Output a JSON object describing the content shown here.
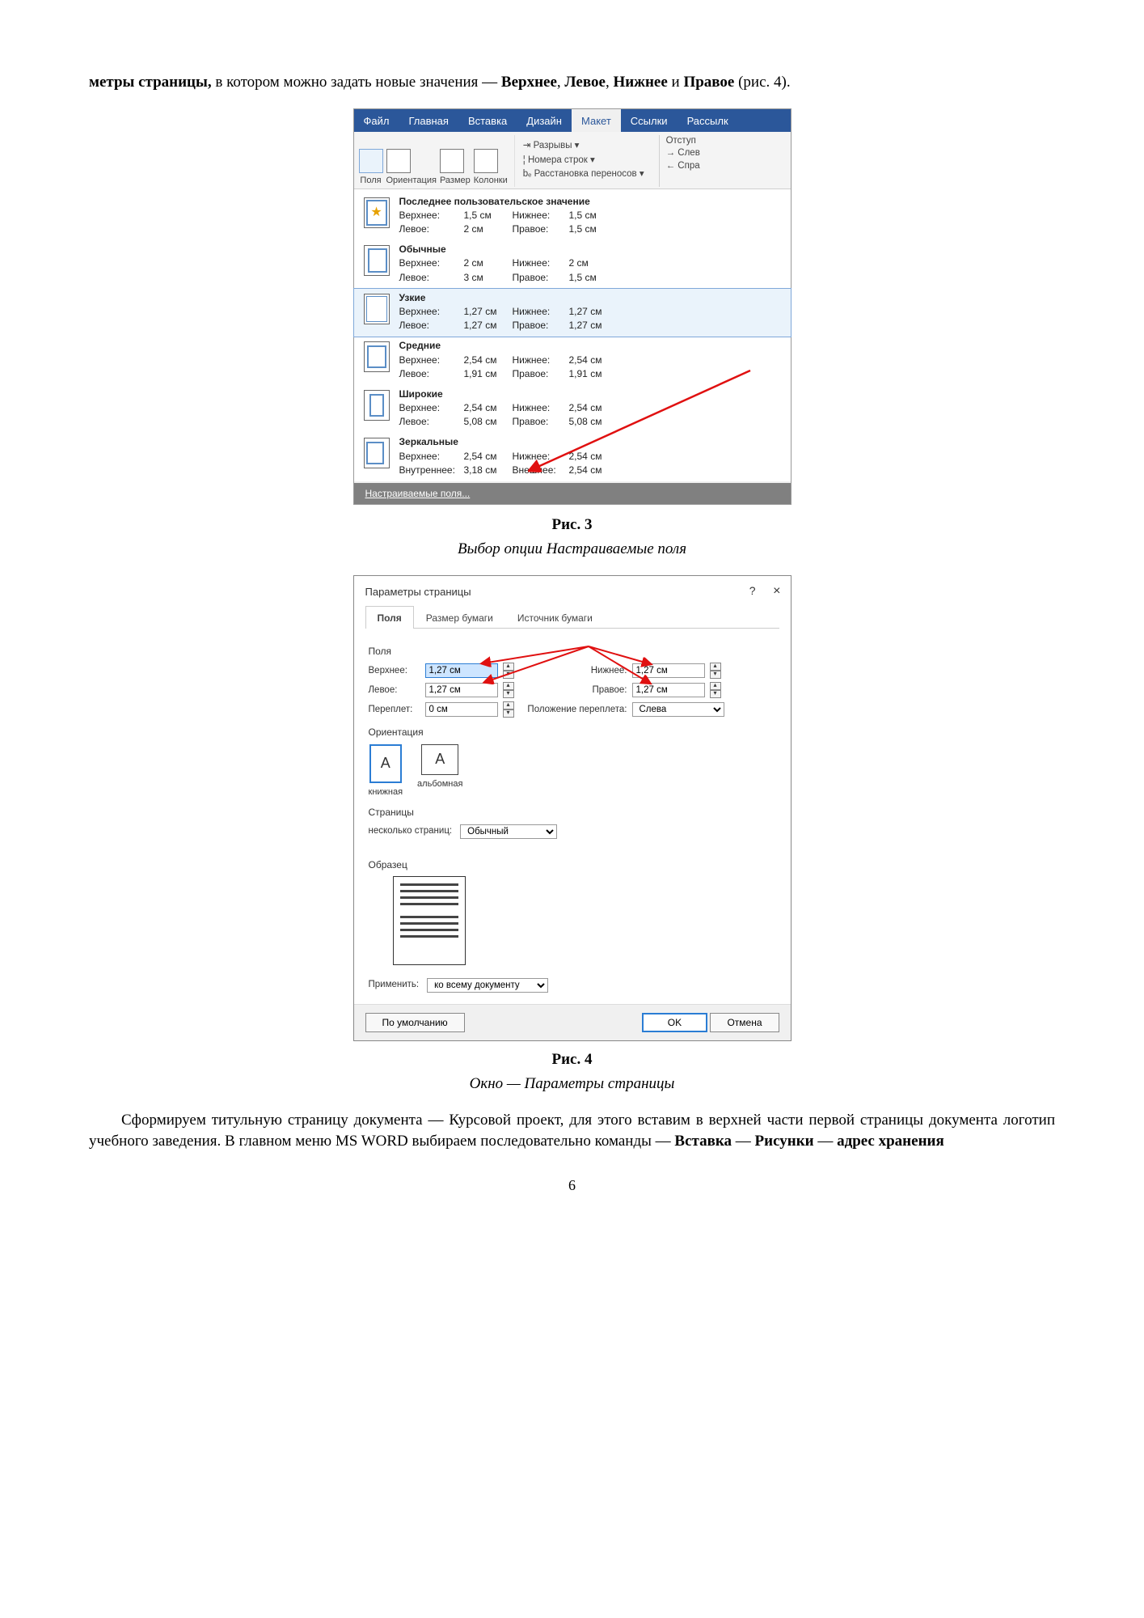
{
  "para1_prefix": "метры страницы,",
  "para1_mid": " в котором можно задать новые значения — ",
  "para1_names": [
    "Верхнее",
    "Левое",
    "Нижнее",
    "Правое"
  ],
  "para1_suffix": " (рис. 4).",
  "ribbon": {
    "tabs": [
      "Файл",
      "Главная",
      "Вставка",
      "Дизайн",
      "Макет",
      "Ссылки",
      "Рассылк"
    ],
    "active": "Макет",
    "groups": {
      "polya": "Поля",
      "orient": "Ориентация",
      "razmer": "Размер",
      "kolonki": "Колонки",
      "razryvy": "Разрывы",
      "nomera": "Номера строк",
      "rasstan": "Расстановка переносов",
      "otstup": "Отступ",
      "slev": "Слев",
      "spra": "Спра"
    },
    "margin_presets": [
      {
        "key": "last",
        "title": "Последнее пользовательское значение",
        "top_l": "Верхнее:",
        "top_v": "1,5 см",
        "bot_l": "Нижнее:",
        "bot_v": "1,5 см",
        "left_l": "Левое:",
        "left_v": "2 см",
        "right_l": "Правое:",
        "right_v": "1,5 см",
        "star": true
      },
      {
        "key": "normal",
        "title": "Обычные",
        "top_l": "Верхнее:",
        "top_v": "2 см",
        "bot_l": "Нижнее:",
        "bot_v": "2 см",
        "left_l": "Левое:",
        "left_v": "3 см",
        "right_l": "Правое:",
        "right_v": "1,5 см"
      },
      {
        "key": "narrow",
        "title": "Узкие",
        "top_l": "Верхнее:",
        "top_v": "1,27 см",
        "bot_l": "Нижнее:",
        "bot_v": "1,27 см",
        "left_l": "Левое:",
        "left_v": "1,27 см",
        "right_l": "Правое:",
        "right_v": "1,27 см",
        "hl": true
      },
      {
        "key": "middle",
        "title": "Средние",
        "top_l": "Верхнее:",
        "top_v": "2,54 см",
        "bot_l": "Нижнее:",
        "bot_v": "2,54 см",
        "left_l": "Левое:",
        "left_v": "1,91 см",
        "right_l": "Правое:",
        "right_v": "1,91 см"
      },
      {
        "key": "wide",
        "title": "Широкие",
        "top_l": "Верхнее:",
        "top_v": "2,54 см",
        "bot_l": "Нижнее:",
        "bot_v": "2,54 см",
        "left_l": "Левое:",
        "left_v": "5,08 см",
        "right_l": "Правое:",
        "right_v": "5,08 см"
      },
      {
        "key": "mirror",
        "title": "Зеркальные",
        "top_l": "Верхнее:",
        "top_v": "2,54 см",
        "bot_l": "Нижнее:",
        "bot_v": "2,54 см",
        "left_l": "Внутреннее:",
        "left_v": "3,18 см",
        "right_l": "Внешнее:",
        "right_v": "2,54 см"
      }
    ],
    "custom": "Настраиваемые поля..."
  },
  "fig3_caption": "Рис. 3",
  "fig3_sub": "Выбор опции Настраиваемые поля",
  "dialog": {
    "title": "Параметры страницы",
    "help": "?",
    "close": "×",
    "tabs": [
      "Поля",
      "Размер бумаги",
      "Источник бумаги"
    ],
    "active": "Поля",
    "section_polya": "Поля",
    "labels": {
      "top": "Верхнее:",
      "bottom": "Нижнее:",
      "left": "Левое:",
      "right": "Правое:",
      "gutter": "Переплет:",
      "gutter_pos": "Положение переплета:"
    },
    "values": {
      "top": "1,27 см",
      "bottom": "1,27 см",
      "left": "1,27 см",
      "right": "1,27 см",
      "gutter": "0 см",
      "gutter_pos": "Слева"
    },
    "section_orient": "Ориентация",
    "orient_port": "книжная",
    "orient_land": "альбомная",
    "section_pages": "Страницы",
    "multi_pages_l": "несколько страниц:",
    "multi_pages_v": "Обычный",
    "section_preview": "Образец",
    "apply_l": "Применить:",
    "apply_v": "ко всему документу",
    "btn_default": "По умолчанию",
    "btn_ok": "OK",
    "btn_cancel": "Отмена"
  },
  "fig4_caption": "Рис. 4",
  "fig4_sub": "Окно — Параметры страницы",
  "para2_start": "Сформируем титульную страницу документа — Курсовой проект, для этого вставим в верхней части первой страницы документа логотип учебного заведения. В главном меню MS WORD выбираем последовательно команды — ",
  "para2_cmds": [
    "Вставка",
    "Рисунки",
    "адрес хранения"
  ],
  "page_num": "6"
}
